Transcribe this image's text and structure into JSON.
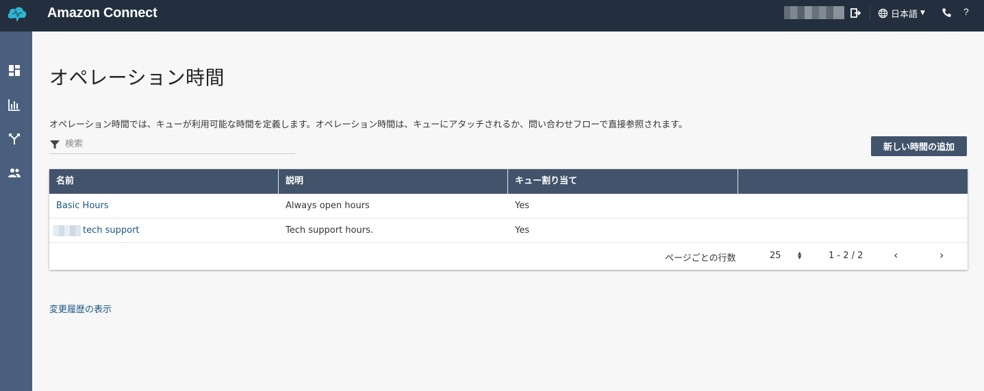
{
  "header": {
    "app_title": "Amazon Connect",
    "language": "日本語",
    "help": "?",
    "icons": [
      "cloud-logo-icon",
      "logout-icon",
      "globe-icon",
      "phone-icon",
      "help-icon"
    ]
  },
  "sidebar": {
    "items": [
      {
        "name": "dashboard",
        "icon": "dashboard-icon"
      },
      {
        "name": "metrics",
        "icon": "bar-chart-icon"
      },
      {
        "name": "routing",
        "icon": "routing-icon"
      },
      {
        "name": "users",
        "icon": "users-icon"
      }
    ]
  },
  "main": {
    "title": "オペレーション時間",
    "description": "オペレーション時間では、キューが利用可能な時間を定義します。オペレーション時間は、キューにアタッチされるか、問い合わせフローで直接参照されます。",
    "search_placeholder": "検索",
    "add_button": "新しい時間の追加",
    "history_link": "変更履歴の表示"
  },
  "table": {
    "columns": [
      "名前",
      "説明",
      "キュー割り当て",
      ""
    ],
    "rows": [
      {
        "name": "Basic Hours",
        "description": "Always open hours",
        "queue": "Yes"
      },
      {
        "name": "tech support",
        "description": "Tech support hours.",
        "queue": "Yes"
      }
    ],
    "pagination": {
      "rows_per_page_label": "ページごとの行数",
      "page_size": "25",
      "range": "1 - 2 / 2",
      "prev": "‹",
      "next": "›"
    }
  },
  "colors": {
    "topbar": "#232f3e",
    "sidebar": "#4a5f7e",
    "table_header": "#42536c",
    "link": "#1b5585",
    "logo_teal": "#2fb5d2"
  }
}
